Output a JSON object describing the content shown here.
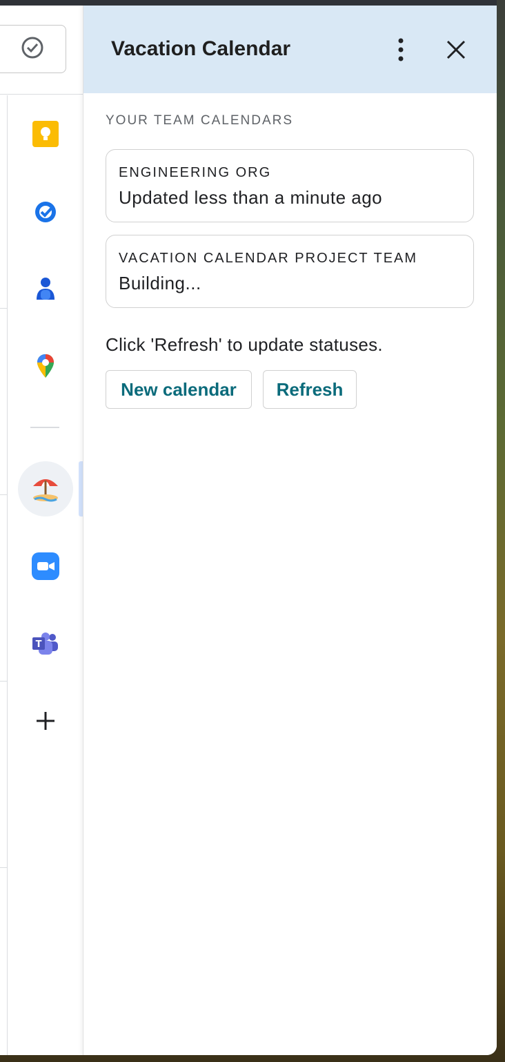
{
  "panel": {
    "title": "Vacation Calendar",
    "section_heading": "YOUR TEAM CALENDARS",
    "calendars": [
      {
        "name": "ENGINEERING ORG",
        "status": "Updated less than a minute ago"
      },
      {
        "name": "VACATION CALENDAR PROJECT TEAM",
        "status": "Building..."
      }
    ],
    "hint": "Click 'Refresh' to update statuses.",
    "new_calendar_label": "New calendar",
    "refresh_label": "Refresh"
  },
  "sidebar": {
    "icons": [
      "keep-icon",
      "tasks-icon",
      "contacts-icon",
      "maps-icon",
      "vacation-calendar-icon",
      "zoom-icon",
      "teams-icon",
      "add-icon"
    ]
  },
  "colors": {
    "header_bg": "#d9e8f5",
    "button_text": "#0b6b7b",
    "keep": "#fbbc04",
    "tasks": "#1a73e8",
    "contacts": "#1a57d6",
    "zoom": "#2d8cff",
    "teams": "#5059c9"
  }
}
